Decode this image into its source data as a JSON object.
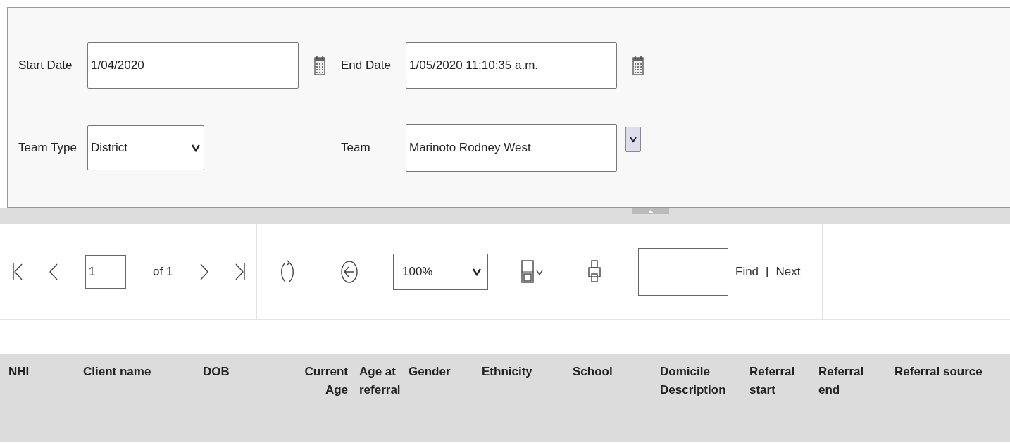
{
  "parameters": {
    "start_date": {
      "label": "Start Date",
      "value": "1/04/2020"
    },
    "end_date": {
      "label": "End Date",
      "value": "1/05/2020 11:10:35 a.m."
    },
    "team_type": {
      "label": "Team Type",
      "value": "District"
    },
    "team": {
      "label": "Team",
      "value": "Marinoto Rodney West"
    }
  },
  "toolbar": {
    "page": "1",
    "page_count": "of 1",
    "zoom": "100%",
    "find": "Find",
    "find_separator": "|",
    "next": "Next"
  },
  "table": {
    "columns": [
      {
        "label": "NHI"
      },
      {
        "label": "Client name"
      },
      {
        "label": "DOB"
      },
      {
        "label": "Current\nAge"
      },
      {
        "label": "Age at\nreferral"
      },
      {
        "label": "Gender"
      },
      {
        "label": "Ethnicity"
      },
      {
        "label": "School"
      },
      {
        "label": "Domicile\nDescription"
      },
      {
        "label": "Referral\nstart"
      },
      {
        "label": "Referral\nend"
      },
      {
        "label": "Referral source"
      }
    ]
  }
}
